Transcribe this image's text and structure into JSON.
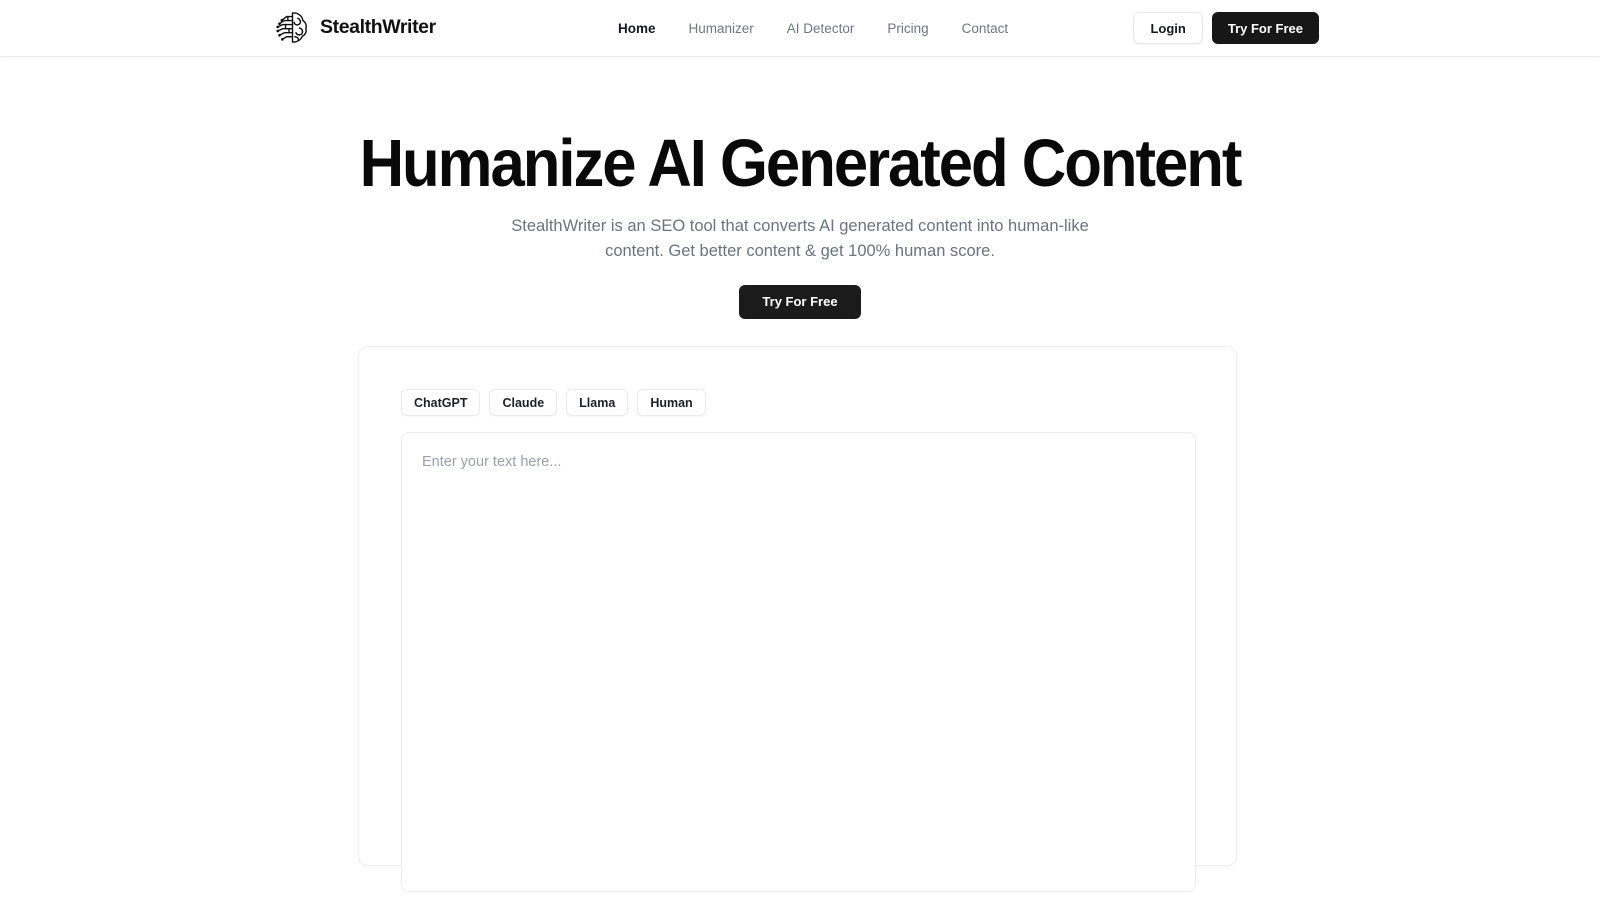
{
  "header": {
    "brand": {
      "name": "StealthWriter",
      "logo_icon": "brain-circuit-icon"
    },
    "nav": [
      {
        "label": "Home",
        "active": true
      },
      {
        "label": "Humanizer",
        "active": false
      },
      {
        "label": "AI Detector",
        "active": false
      },
      {
        "label": "Pricing",
        "active": false
      },
      {
        "label": "Contact",
        "active": false
      }
    ],
    "login_label": "Login",
    "cta_label": "Try For Free"
  },
  "hero": {
    "title": "Humanize AI Generated Content",
    "subtitle": "StealthWriter is an SEO tool that converts AI generated content into human-like content. Get better content & get 100% human score.",
    "cta_label": "Try For Free"
  },
  "tool": {
    "model_tabs": [
      {
        "label": "ChatGPT"
      },
      {
        "label": "Claude"
      },
      {
        "label": "Llama"
      },
      {
        "label": "Human"
      }
    ],
    "editor": {
      "value": "",
      "placeholder": "Enter your text here..."
    }
  },
  "colors": {
    "accent_dark": "#171717",
    "text_primary": "#111111",
    "text_muted": "#6b7280",
    "border": "#eceef0",
    "background": "#ffffff"
  }
}
